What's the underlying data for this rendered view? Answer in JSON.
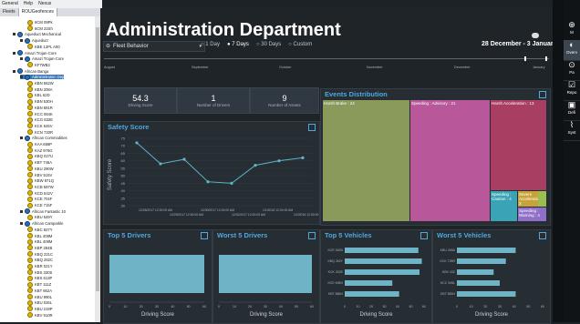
{
  "menu": [
    "General",
    "Help",
    "Nexus"
  ],
  "tree_tabs": [
    "Fleets",
    "ROUGeofences"
  ],
  "tree": [
    {
      "label": "6CM 09Pk",
      "type": "y",
      "indent": 30
    },
    {
      "label": "6CM 22Sh",
      "type": "y",
      "indent": 30
    },
    {
      "label": "Aqueduct Mechanical",
      "type": "b",
      "indent": 14
    },
    {
      "label": "Aqueduct",
      "type": "b",
      "indent": 22
    },
    {
      "label": "KBE 12PL  A00",
      "type": "y",
      "indent": 30
    },
    {
      "label": "Amazi Trojan-Core",
      "type": "b",
      "indent": 14
    },
    {
      "label": "Amazi Trojan-Core",
      "type": "b",
      "indent": 22
    },
    {
      "label": "KF7WB3",
      "type": "y",
      "indent": 30
    },
    {
      "label": "African Banga",
      "type": "b",
      "indent": 14
    },
    {
      "label": "Administration Dep",
      "type": "b",
      "indent": 22,
      "sel": true
    },
    {
      "label": "KBN 562W",
      "type": "y",
      "indent": 30
    },
    {
      "label": "KBN 208A",
      "type": "y",
      "indent": 30
    },
    {
      "label": "KBL 62D",
      "type": "y",
      "indent": 30
    },
    {
      "label": "KBN 530H",
      "type": "y",
      "indent": 30
    },
    {
      "label": "KBN 891R",
      "type": "y",
      "indent": 30
    },
    {
      "label": "KCC 064K",
      "type": "y",
      "indent": 30
    },
    {
      "label": "KCG 832E",
      "type": "y",
      "indent": 30
    },
    {
      "label": "KCK 645V",
      "type": "y",
      "indent": 30
    },
    {
      "label": "KCN 720R",
      "type": "y",
      "indent": 30
    },
    {
      "label": "African Commodities",
      "type": "b",
      "indent": 22
    },
    {
      "label": "KAA 668P",
      "type": "y",
      "indent": 30
    },
    {
      "label": "KAZ 976G",
      "type": "y",
      "indent": 30
    },
    {
      "label": "KBQ 027U",
      "type": "y",
      "indent": 30
    },
    {
      "label": "KBT 746A",
      "type": "y",
      "indent": 30
    },
    {
      "label": "KBU 290W",
      "type": "y",
      "indent": 30
    },
    {
      "label": "KBV 515V",
      "type": "y",
      "indent": 30
    },
    {
      "label": "KBW 871Q",
      "type": "y",
      "indent": 30
    },
    {
      "label": "KCB 597W",
      "type": "y",
      "indent": 30
    },
    {
      "label": "KCD 642V",
      "type": "y",
      "indent": 30
    },
    {
      "label": "KCE 704F",
      "type": "y",
      "indent": 30
    },
    {
      "label": "KCE 715F",
      "type": "y",
      "indent": 30
    },
    {
      "label": "African Fantastic 10",
      "type": "b",
      "indent": 22
    },
    {
      "label": "KBU 549Y",
      "type": "y",
      "indent": 30
    },
    {
      "label": "African Carsparkle",
      "type": "b",
      "indent": 22
    },
    {
      "label": "KBC 827Y",
      "type": "y",
      "indent": 30
    },
    {
      "label": "KBL 408M",
      "type": "y",
      "indent": 30
    },
    {
      "label": "KBL 409M",
      "type": "y",
      "indent": 30
    },
    {
      "label": "KBP 284B",
      "type": "y",
      "indent": 30
    },
    {
      "label": "KBQ 221C",
      "type": "y",
      "indent": 30
    },
    {
      "label": "KBQ 252C",
      "type": "y",
      "indent": 30
    },
    {
      "label": "KBR 021Y",
      "type": "y",
      "indent": 30
    },
    {
      "label": "KBS 330S",
      "type": "y",
      "indent": 30
    },
    {
      "label": "KBS 613P",
      "type": "y",
      "indent": 30
    },
    {
      "label": "KBT 111Z",
      "type": "y",
      "indent": 30
    },
    {
      "label": "KBT 662A",
      "type": "y",
      "indent": 30
    },
    {
      "label": "KBU 990L",
      "type": "y",
      "indent": 30
    },
    {
      "label": "KBU 026L",
      "type": "y",
      "indent": 30
    },
    {
      "label": "KBU 219P",
      "type": "y",
      "indent": 30
    },
    {
      "label": "KBV 910R",
      "type": "y",
      "indent": 30
    }
  ],
  "header": {
    "title": "Administration Department",
    "filter": "Fleet Behavior",
    "periods": [
      "1 Day",
      "7 Days",
      "30 Days",
      "Custom"
    ],
    "selected_period": "7 Days",
    "date_range": "28 December - 3 January"
  },
  "timeline_months": [
    "August",
    "September",
    "October",
    "November",
    "December",
    "January"
  ],
  "cards": [
    {
      "value": "54.3",
      "label": "Driving Score"
    },
    {
      "value": "1",
      "label": "Number of Drivers"
    },
    {
      "value": "9",
      "label": "Number of Assets"
    }
  ],
  "panels": {
    "safety": "Safety Score",
    "events": "Events Distribution",
    "top_drivers": "Top 5 Drivers",
    "worst_drivers": "Worst 5 Drivers",
    "top_vehicles": "Top 5 Vehicles",
    "worst_vehicles": "Worst 5 Vehicles",
    "driving_score_axis": "Driving Score"
  },
  "safety_chart": {
    "ylabel": "Safety Score",
    "yticks": [
      "75",
      "70",
      "65",
      "60",
      "55",
      "50",
      "45",
      "40",
      "35",
      "30"
    ],
    "values": [
      72,
      58,
      61,
      46,
      45,
      57,
      60,
      62
    ],
    "ymin": 30,
    "ymax": 75,
    "xticks": [
      "12/28/2017 12:00:00 AM",
      "12/29/2017 12:00:00 AM",
      "12/30/2017 12:00:00 AM",
      "12/31/2017 12:00:00 AM",
      "1/1/2018 12:00:00 AM",
      "1/2/2018 12:00:00 AM"
    ]
  },
  "events": [
    {
      "label": "Harsh Brake : 24",
      "color": "#8a9a5b"
    },
    {
      "label": "Speeding : Advisory : 21",
      "color": "#b8589b"
    },
    {
      "label": "Harsh Acceleration : 13",
      "color": "#a83f63"
    },
    {
      "label": "Speeding : Caution : 4",
      "color": "#3aa3b5"
    },
    {
      "label": "Severe Acceleration : 3",
      "color": "#c8a23a"
    },
    {
      "label": "Speeding : Warning : 4",
      "color": "#8f6fc7"
    },
    {
      "label": "",
      "color": "#9bbf4f"
    }
  ],
  "top_vehicles": {
    "plates": [
      "KCE 342N",
      "KBQ 262Y",
      "KCK 332E",
      "KCE 695H",
      "KBT 886H"
    ],
    "values": [
      65,
      68,
      66,
      42,
      48
    ]
  },
  "worst_vehicles": {
    "plates": [
      "KBU 266A",
      "KCK 728R",
      "KBV 43Z",
      "KCC 945L",
      "KBT 883H"
    ],
    "values": [
      48,
      40,
      30,
      35,
      48
    ]
  },
  "score_ticks": [
    "0",
    "10",
    "20",
    "30",
    "40",
    "50",
    "60"
  ],
  "rside": [
    {
      "label": "M",
      "icon": "⊕"
    },
    {
      "label": "Overv",
      "icon": "◐"
    },
    {
      "label": "Pa",
      "icon": "⊙"
    },
    {
      "label": "Repo",
      "icon": "☑"
    },
    {
      "label": "Defi",
      "icon": "▣"
    },
    {
      "label": "Syst",
      "icon": "⌇"
    }
  ],
  "colors": {
    "accent": "#4fa8e0",
    "bar": "#6fb3c6",
    "line": "#5fb6c8"
  }
}
